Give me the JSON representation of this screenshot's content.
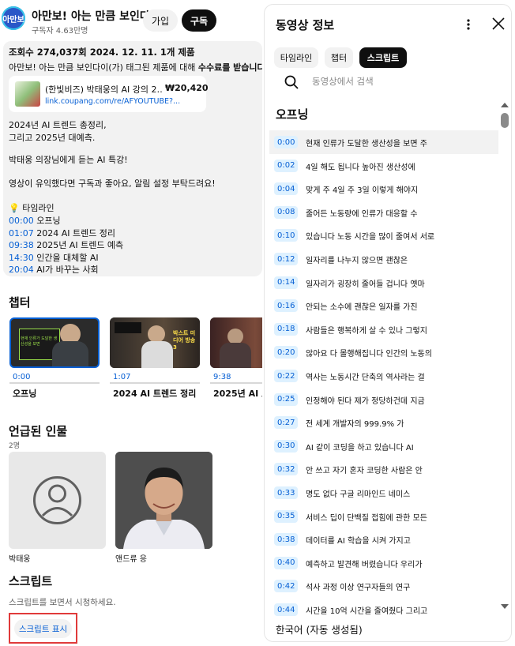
{
  "channel": {
    "avatar_text": "아만보",
    "name": "아만보! 아는 만큼 보인다",
    "subscribers": "구독자 4.63만명",
    "join_label": "가입",
    "subscribe_label": "구독"
  },
  "description": {
    "stats": "조회수 274,037회  2024. 12. 11.  1개 제품",
    "promo_prefix": "아만보! 아는 만큼 보인다이(가) 태그된 제품에 대해 ",
    "promo_bold": "수수료를 받습니다",
    "promo_suffix": ". ",
    "promo_more": "자",
    "product": {
      "title": "(한빛비즈) 박태웅의 AI 강의 2…",
      "price": "₩20,420",
      "link": "link.coupang.com/re/AFYOUTUBE?..."
    },
    "lines": [
      "2024년 AI 트렌드 총정리,",
      "그리고 2025년 대예측.",
      "박태웅 의장님에게 듣는 AI 특강!",
      "영상이 유익했다면 구독과 좋아요, 알림 설정 부탁드려요!",
      "💡 타임라인"
    ],
    "timeline": [
      {
        "time": "00:00",
        "label": " 오프닝"
      },
      {
        "time": "01:07",
        "label": " 2024 AI 트렌드 정리"
      },
      {
        "time": "09:38",
        "label": " 2025년 AI 트렌드 예측"
      },
      {
        "time": "14:30",
        "label": " 인간을 대체할 AI"
      },
      {
        "time": "20:04",
        "label": " AI가 바꾸는 사회"
      }
    ]
  },
  "chapters": {
    "title": "챕터",
    "items": [
      {
        "time": "0:00",
        "title": "오프닝",
        "thumb_caption": "현재 인류가 도달한 생산성을 보면"
      },
      {
        "time": "1:07",
        "title": "2024 AI 트렌드 정리",
        "thumb_caption": "박스트 미디어 방송 3"
      },
      {
        "time": "9:38",
        "title": "2025년 AI 트렌드 예측",
        "thumb_caption": ""
      }
    ]
  },
  "people": {
    "title": "언급된 인물",
    "count": "2명",
    "items": [
      {
        "name": "박태웅"
      },
      {
        "name": "앤드류 응"
      }
    ]
  },
  "script_section": {
    "title": "스크립트",
    "hint": "스크립트를 보면서 시청하세요.",
    "button_label": "스크립트 표시"
  },
  "panel": {
    "title": "동영상 정보",
    "tabs": [
      {
        "label": "타임라인",
        "active": false
      },
      {
        "label": "챕터",
        "active": false
      },
      {
        "label": "스크립트",
        "active": true
      }
    ],
    "search_placeholder": "동영상에서 검색",
    "section": "오프닝",
    "segments": [
      {
        "time": "0:00",
        "text": "현재 인류가 도달한 생산성을 보면 주"
      },
      {
        "time": "0:02",
        "text": "4일 해도 됩니다 높아진 생산성에"
      },
      {
        "time": "0:04",
        "text": "맞게 주 4일 주 3일 이렇게 해야지"
      },
      {
        "time": "0:08",
        "text": "줄어든 노동량에 인류가 대응할 수"
      },
      {
        "time": "0:10",
        "text": "있습니다 노동 시간을 많이 줄여서 서로"
      },
      {
        "time": "0:12",
        "text": "일자리를 나누지 않으면 괜찮은"
      },
      {
        "time": "0:14",
        "text": "일자리가 굉장히 줄어들 겁니다 옛마"
      },
      {
        "time": "0:16",
        "text": "안되는 소수에 괜찮은 일자를 가진"
      },
      {
        "time": "0:18",
        "text": "사람들은 행복하게 살 수 있나 그렇지"
      },
      {
        "time": "0:20",
        "text": "않아요 다 몰행해집니다 인간의 노동의"
      },
      {
        "time": "0:22",
        "text": "역사는 노동시간 단축의 역사라는 걸"
      },
      {
        "time": "0:25",
        "text": "인정해야 된다 제가 정당하건데 지금"
      },
      {
        "time": "0:27",
        "text": "전 세계 개발자의 999.9% 가"
      },
      {
        "time": "0:30",
        "text": "AI 같이 코딩을 하고 있습니다 AI"
      },
      {
        "time": "0:32",
        "text": "안 쓰고 자기 혼자 코딩한 사람은 안"
      },
      {
        "time": "0:33",
        "text": "명도 없다 구글 리마인드 네미스"
      },
      {
        "time": "0:35",
        "text": "서비스 딥이 단백질 접힘에 관한 모든"
      },
      {
        "time": "0:38",
        "text": "데이터를 AI 학습을 시켜 가지고"
      },
      {
        "time": "0:40",
        "text": "예측하고 발견해 버렸습니다 우리가"
      },
      {
        "time": "0:42",
        "text": "석사 과정 이상 연구자들의 연구"
      },
      {
        "time": "0:44",
        "text": "시간을 10억 시간을 줄여줬다 그리고"
      }
    ],
    "language": "한국어 (자동 생성됨)"
  },
  "colors": {
    "link": "#065fd4",
    "highlight_border": "#e03a3a",
    "chip_active": "#0f0f0f"
  }
}
